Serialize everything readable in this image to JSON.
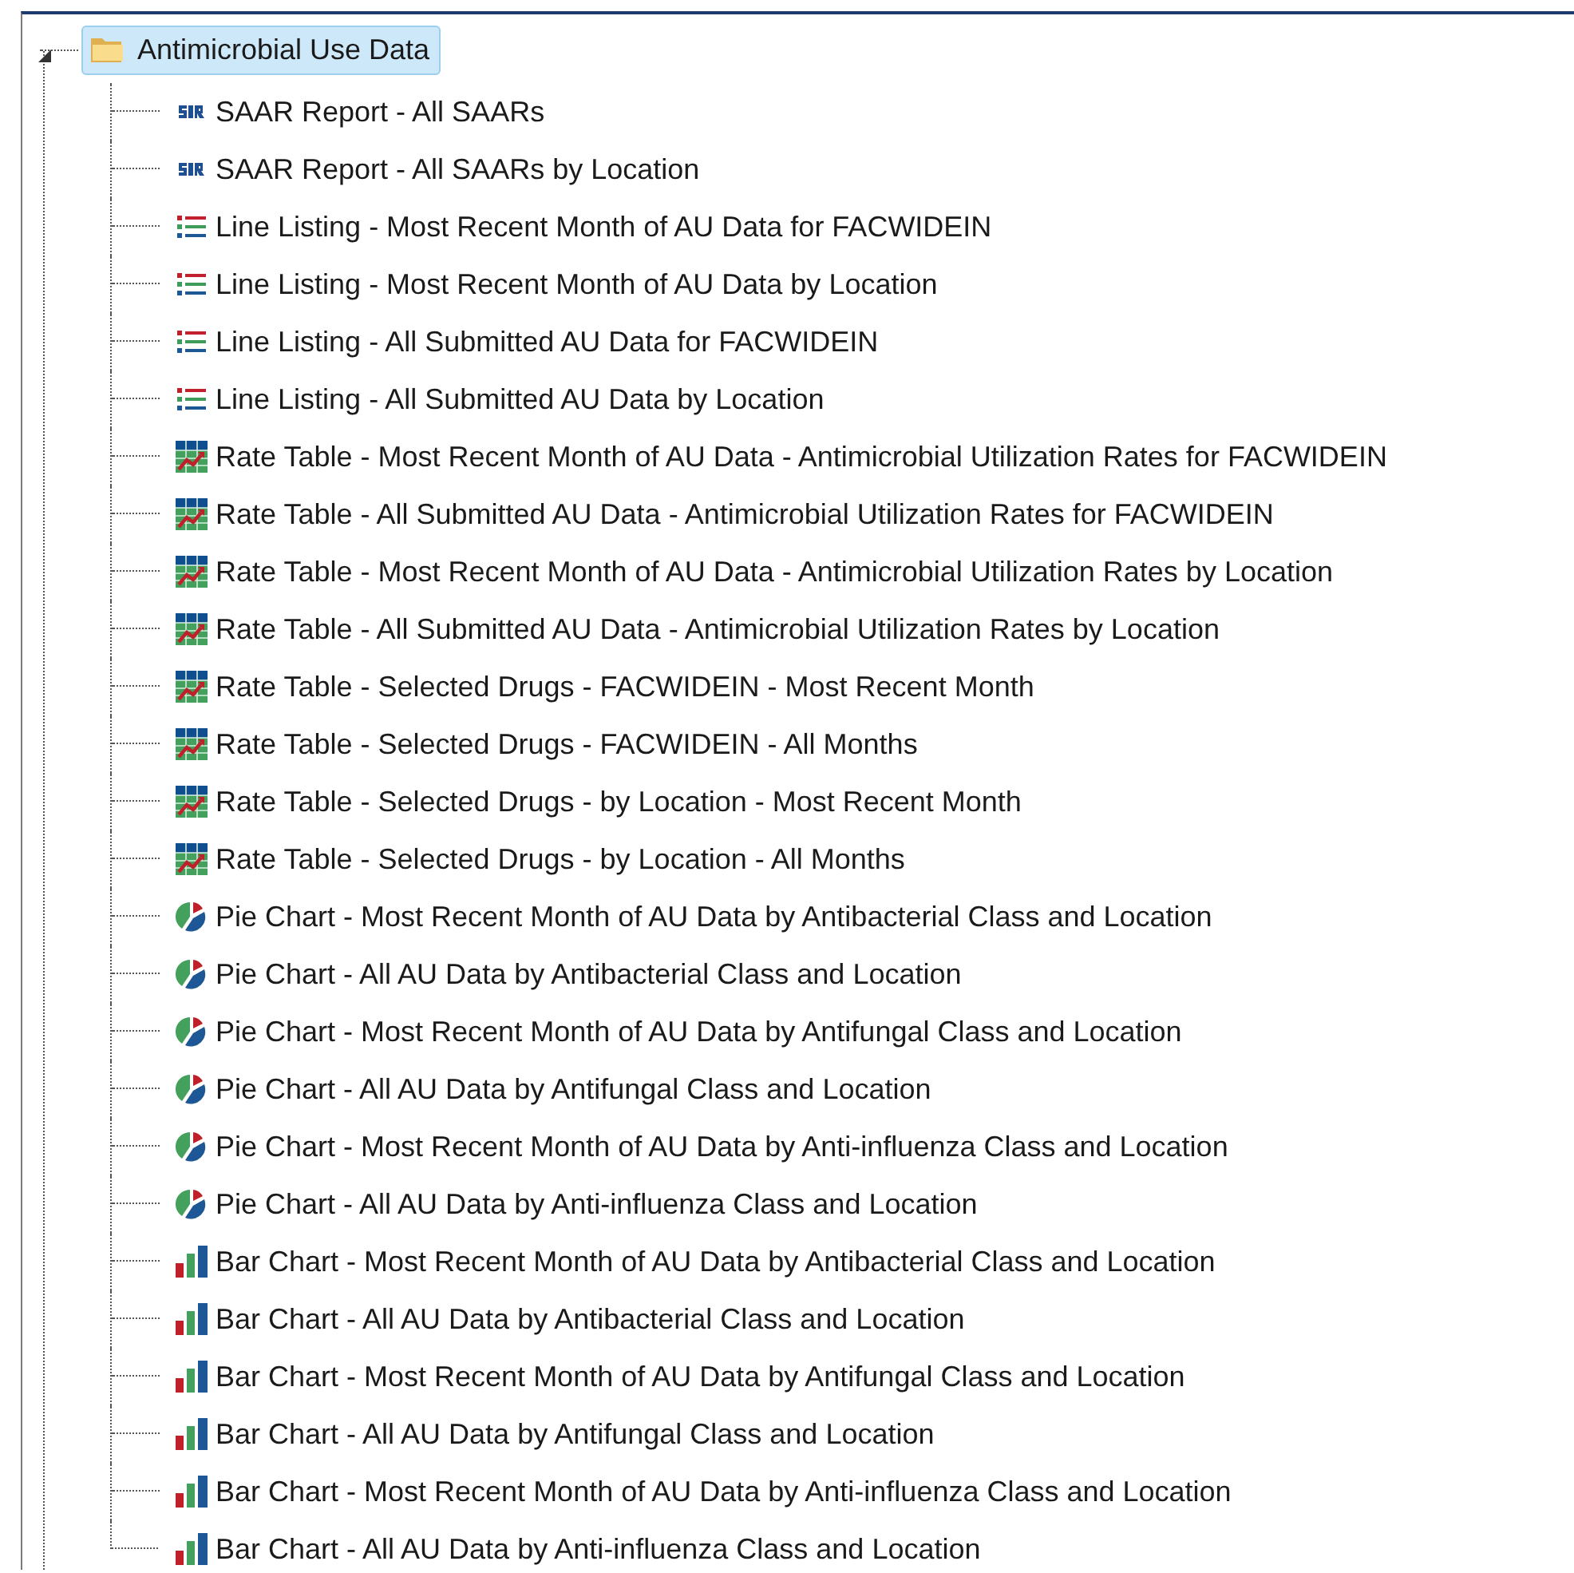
{
  "tree": {
    "root": {
      "label": "Antimicrobial Use Data",
      "expanded": true,
      "selected": true,
      "children": [
        {
          "label": "SAAR Report - All SAARs",
          "kind": "sir",
          "selected": false
        },
        {
          "label": "SAAR Report - All SAARs by Location",
          "kind": "sir",
          "selected": false
        },
        {
          "label": "Line Listing - Most Recent Month of AU Data for FACWIDEIN",
          "kind": "list",
          "selected": false
        },
        {
          "label": "Line Listing - Most Recent Month of AU Data by Location",
          "kind": "list",
          "selected": false
        },
        {
          "label": "Line Listing - All Submitted AU Data for FACWIDEIN",
          "kind": "list",
          "selected": false
        },
        {
          "label": "Line Listing - All Submitted AU Data by Location",
          "kind": "list",
          "selected": false
        },
        {
          "label": "Rate Table - Most Recent Month of AU Data - Antimicrobial Utilization Rates for FACWIDEIN",
          "kind": "rate",
          "selected": false
        },
        {
          "label": "Rate Table - All Submitted AU Data - Antimicrobial Utilization Rates for FACWIDEIN",
          "kind": "rate",
          "selected": false
        },
        {
          "label": "Rate Table - Most Recent Month of AU Data - Antimicrobial Utilization Rates by Location",
          "kind": "rate",
          "selected": false
        },
        {
          "label": "Rate Table - All Submitted AU Data - Antimicrobial Utilization Rates by Location",
          "kind": "rate",
          "selected": false
        },
        {
          "label": "Rate Table - Selected Drugs - FACWIDEIN - Most Recent Month",
          "kind": "rate",
          "selected": false
        },
        {
          "label": "Rate Table - Selected Drugs - FACWIDEIN - All Months",
          "kind": "rate",
          "selected": false
        },
        {
          "label": "Rate Table - Selected Drugs - by Location - Most Recent Month",
          "kind": "rate",
          "selected": false
        },
        {
          "label": "Rate Table - Selected Drugs - by Location - All Months",
          "kind": "rate",
          "selected": false
        },
        {
          "label": "Pie Chart - Most Recent Month of AU Data by Antibacterial Class and Location",
          "kind": "pie",
          "selected": false
        },
        {
          "label": "Pie Chart - All AU Data by Antibacterial Class and Location",
          "kind": "pie",
          "selected": false
        },
        {
          "label": "Pie Chart - Most Recent Month of AU Data by Antifungal Class and Location",
          "kind": "pie",
          "selected": false
        },
        {
          "label": "Pie Chart - All AU Data by Antifungal Class and Location",
          "kind": "pie",
          "selected": false
        },
        {
          "label": "Pie Chart - Most Recent Month of AU Data by Anti-influenza Class and Location",
          "kind": "pie",
          "selected": false
        },
        {
          "label": "Pie Chart - All AU Data by Anti-influenza Class and Location",
          "kind": "pie",
          "selected": false
        },
        {
          "label": "Bar Chart - Most Recent Month of AU Data by Antibacterial Class and Location",
          "kind": "bar",
          "selected": false
        },
        {
          "label": "Bar Chart - All AU Data by Antibacterial Class and Location",
          "kind": "bar",
          "selected": false
        },
        {
          "label": "Bar Chart - Most Recent Month of AU Data by Antifungal Class and Location",
          "kind": "bar",
          "selected": false
        },
        {
          "label": "Bar Chart - All AU Data by Antifungal Class and Location",
          "kind": "bar",
          "selected": false
        },
        {
          "label": "Bar Chart - Most Recent Month of AU Data by Anti-influenza Class and Location",
          "kind": "bar",
          "selected": false
        },
        {
          "label": "Bar Chart - All AU Data by Anti-influenza Class and Location",
          "kind": "bar",
          "selected": false
        }
      ]
    }
  }
}
